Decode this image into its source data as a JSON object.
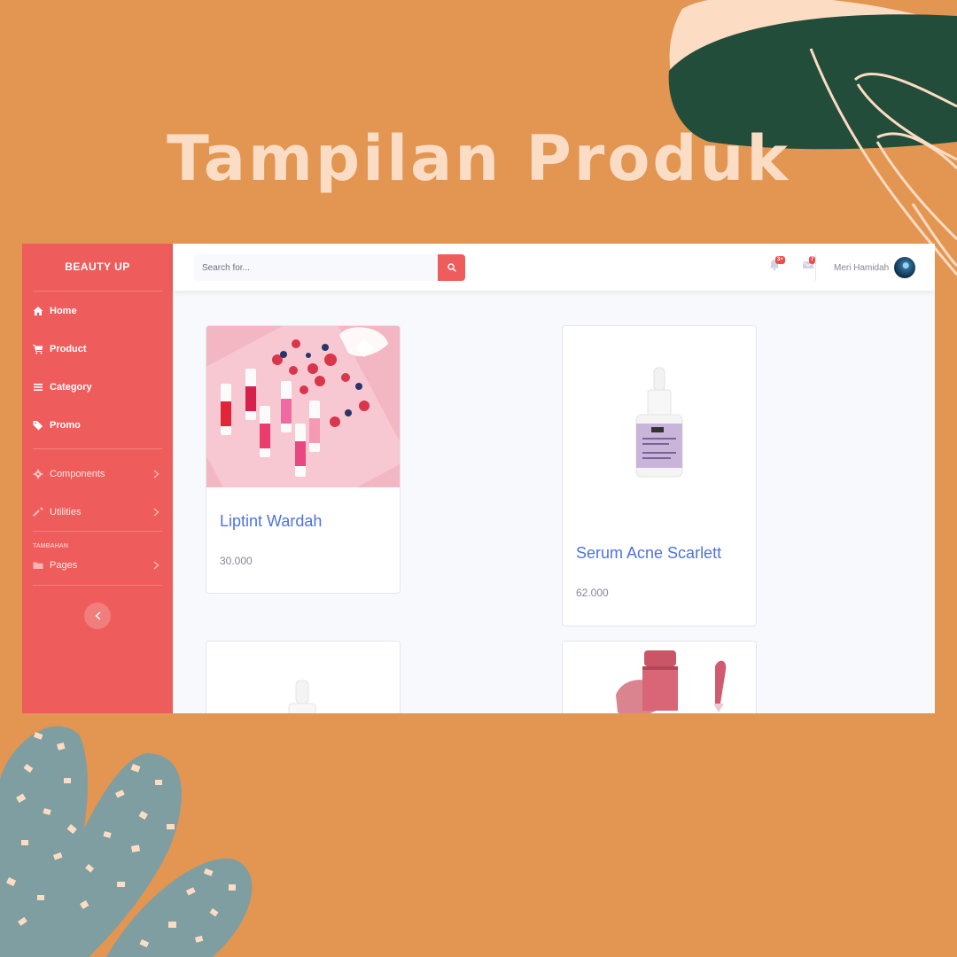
{
  "headline": "Tampilan Produk",
  "sidebar": {
    "brand": "BEAUTY UP",
    "nav": [
      {
        "label": "Home",
        "icon": "home-icon"
      },
      {
        "label": "Product",
        "icon": "cart-icon"
      },
      {
        "label": "Category",
        "icon": "list-icon"
      },
      {
        "label": "Promo",
        "icon": "tags-icon"
      }
    ],
    "group": [
      {
        "label": "Components",
        "icon": "cog-icon"
      },
      {
        "label": "Utilities",
        "icon": "wrench-icon"
      }
    ],
    "heading": "TAMBAHAN",
    "extra": [
      {
        "label": "Pages",
        "icon": "folder-icon"
      }
    ]
  },
  "topbar": {
    "search_placeholder": "Search for...",
    "alerts_badge": "3+",
    "messages_badge": "7",
    "user_name": "Meri Hamidah"
  },
  "products": [
    {
      "name": "Liptint Wardah",
      "price": "30.000"
    },
    {
      "name": "Serum Acne Scarlett",
      "price": "62.000"
    },
    {
      "name": "",
      "price": ""
    },
    {
      "name": "",
      "price": ""
    }
  ],
  "colors": {
    "background": "#E39552",
    "sidebar": "#EE5D5C",
    "headline": "#FADDC4",
    "product_title": "#4E73DF",
    "leaf_dark": "#234D3B",
    "leaf_light": "#FCDCC2",
    "plant": "#7E9EA2"
  }
}
